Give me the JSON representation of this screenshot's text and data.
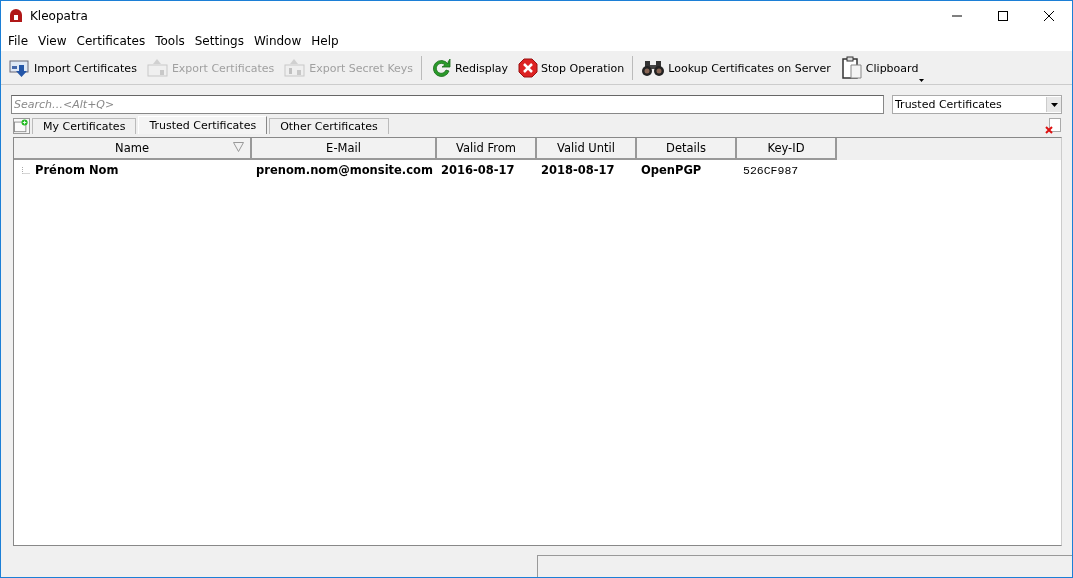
{
  "window": {
    "title": "Kleopatra"
  },
  "menu": [
    "File",
    "View",
    "Certificates",
    "Tools",
    "Settings",
    "Window",
    "Help"
  ],
  "toolbar": [
    [
      {
        "label": "Import Certificates",
        "disabled": false
      },
      {
        "label": "Export Certificates",
        "disabled": true
      },
      {
        "label": "Export Secret Keys",
        "disabled": true
      }
    ],
    [
      {
        "label": "Redisplay",
        "disabled": false
      },
      {
        "label": "Stop Operation",
        "disabled": false
      }
    ],
    [
      {
        "label": "Lookup Certificates on Server",
        "disabled": false
      },
      {
        "label": "Clipboard",
        "disabled": false
      }
    ]
  ],
  "search": {
    "placeholder": "Search…<Alt+Q>"
  },
  "filter": {
    "value": "Trusted Certificates"
  },
  "tabs": [
    {
      "label": "My Certificates",
      "selected": false
    },
    {
      "label": "Trusted Certificates",
      "selected": true
    },
    {
      "label": "Other Certificates",
      "selected": false
    }
  ],
  "table": {
    "columns": [
      "Name",
      "E-Mail",
      "Valid From",
      "Valid Until",
      "Details",
      "Key-ID"
    ],
    "rows": [
      [
        "Prénom Nom",
        "prenom.nom@monsite.com",
        "2016-08-17",
        "2018-08-17",
        "OpenPGP",
        "526CF987"
      ]
    ]
  }
}
